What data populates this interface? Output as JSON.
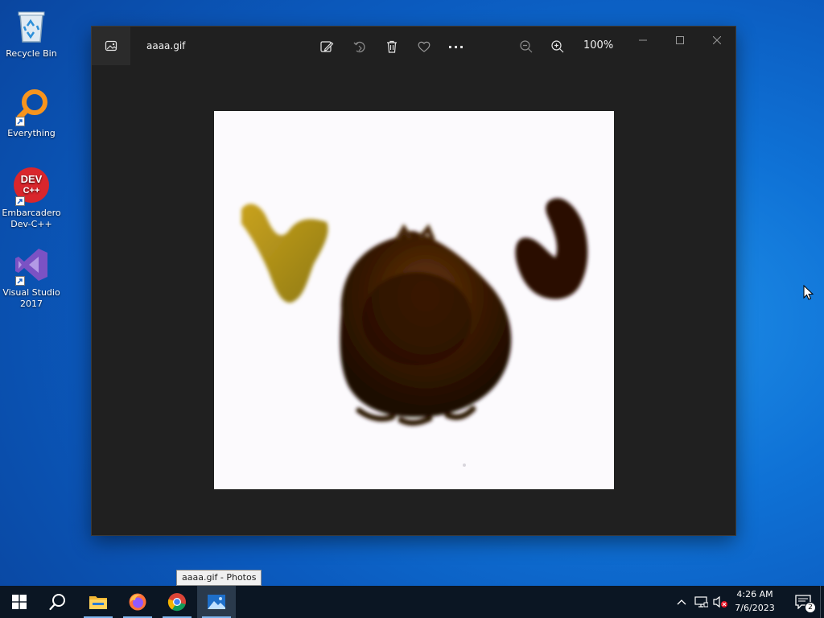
{
  "desktop": {
    "icons": [
      {
        "label": "Recycle Bin"
      },
      {
        "label": "Everything"
      },
      {
        "label": "Embarcadero Dev-C++",
        "logo_text": "DEV\nC++"
      },
      {
        "label": "Visual Studio 2017"
      }
    ]
  },
  "window": {
    "file_name": "aaaa.gif",
    "zoom": "100%",
    "toolbar": [
      "edit-create-icon",
      "rotate-icon",
      "delete-icon",
      "favorite-icon",
      "more-icon",
      "zoom-out-icon",
      "zoom-in-icon"
    ],
    "more_label": "···"
  },
  "tooltip": "aaaa.gif - Photos",
  "taskbar": {
    "apps": [
      "start",
      "search",
      "file-explorer",
      "firefox",
      "chrome",
      "photos"
    ],
    "clock_time": "4:26 AM",
    "clock_date": "7/6/2023",
    "notification_count": "2"
  },
  "colors": {
    "window_bg": "#202020",
    "taskbar_bg": "#0b1623",
    "desktop_accent": "#0f72d6"
  }
}
